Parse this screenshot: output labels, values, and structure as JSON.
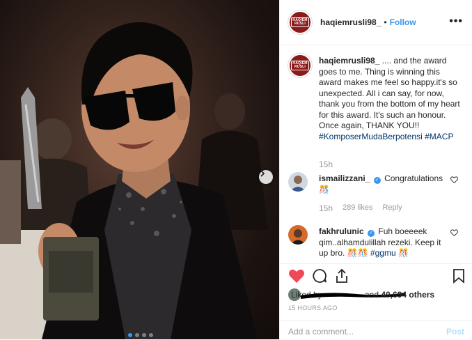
{
  "post_author": {
    "username": "haqiemrusli98_",
    "separator": "•",
    "follow_label": "Follow",
    "more_label": "•••",
    "avatar_text_line1": "HAQIEM",
    "avatar_text_line2": "RUSLI"
  },
  "caption": {
    "username": "haqiemrusli98_",
    "text": ".... and the award goes to me. Thing is winning this award makes me feel so happy.it's so unexpected. All i can say, for now, thank you from the bottom of my heart for this award. It's such an honour. Once again, THANK YOU!!",
    "hashtag1": "#KomposerMudaBerpotensi",
    "hashtag2": "#MACP",
    "time": "15h"
  },
  "comments": [
    {
      "username": "ismailizzani_",
      "text": "Congratulations 🎊",
      "time": "15h",
      "likes": "289 likes",
      "reply": "Reply"
    },
    {
      "username": "fakhrulunic",
      "text": "Fuh boeeeek qim..alhamdulillah rezeki. Keep it up bro. 🎊🎊",
      "hashtag": "#ggmu",
      "tail": "🎊"
    }
  ],
  "likes": {
    "liked_by": "Liked by",
    "and": "and",
    "count": "40,694 others"
  },
  "timestamp": "15 HOURS AGO",
  "add_comment": {
    "placeholder": "Add a comment...",
    "post_label": "Post"
  },
  "carousel": {
    "slides": 4,
    "active_index": 0
  },
  "colors": {
    "accent_blue": "#3897f0",
    "heart_red": "#ed4956",
    "avatar_red": "#8b1a1a",
    "hashtag": "#003569",
    "meta_gray": "#999999"
  },
  "icons": [
    "more-icon",
    "next-arrow-icon",
    "verified-icon",
    "heart-icon",
    "comment-icon",
    "share-icon",
    "bookmark-icon"
  ]
}
